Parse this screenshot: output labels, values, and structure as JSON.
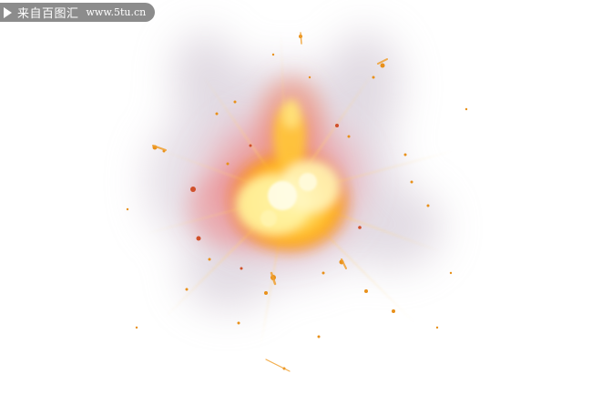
{
  "watermark": {
    "site_name": "来自百图汇",
    "url": "www.5tu.cn"
  },
  "image": {
    "subject_icon": "explosion-icon",
    "colors": {
      "background": "#ffffff",
      "core": "#fff6b0",
      "fire": "#ffb81c",
      "glow": "#f06a4a",
      "smoke": "#c8bccb"
    }
  }
}
